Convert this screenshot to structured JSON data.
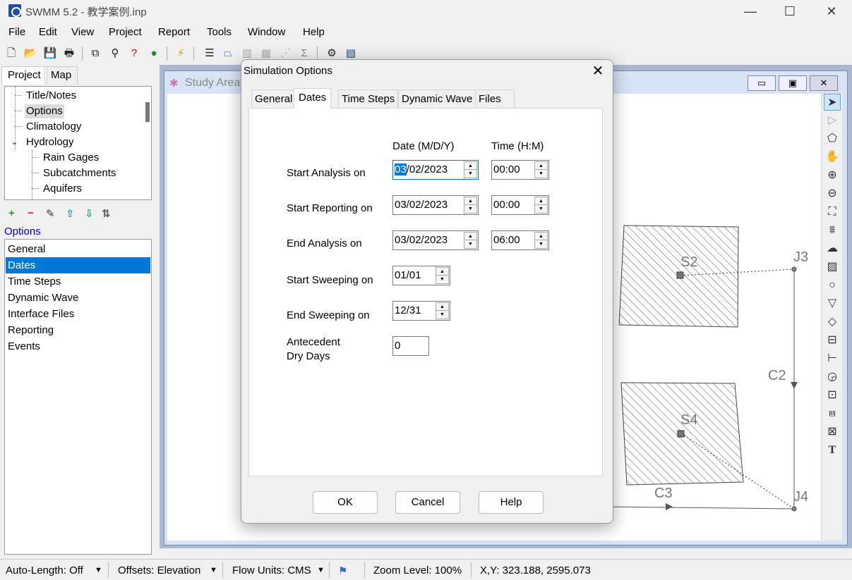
{
  "app": {
    "title": "SWMM 5.2 - 教学案例.inp",
    "window_controls": [
      "—",
      "☐",
      "✕"
    ]
  },
  "menu": [
    "File",
    "Edit",
    "View",
    "Project",
    "Report",
    "Tools",
    "Window",
    "Help"
  ],
  "project_panel": {
    "tabs": [
      "Project",
      "Map"
    ],
    "tree": [
      "Title/Notes",
      "Options",
      "Climatology",
      "Hydrology",
      "Rain Gages",
      "Subcatchments",
      "Aquifers"
    ],
    "options_label": "Options",
    "options_list": [
      "General",
      "Dates",
      "Time Steps",
      "Dynamic Wave",
      "Interface Files",
      "Reporting",
      "Events"
    ]
  },
  "map_window": {
    "title": "Study Area",
    "buttons": [
      "▭",
      "▣",
      "✕"
    ],
    "nodes": [
      "J3",
      "J4"
    ],
    "links": [
      "C2",
      "C3"
    ],
    "subcatchments": [
      "S2",
      "S4"
    ]
  },
  "dialog": {
    "title": "Simulation Options",
    "close_icon": "✕",
    "tabs": [
      "General",
      "Dates",
      "Time Steps",
      "Dynamic Wave",
      "Files"
    ],
    "col_date": "Date (M/D/Y)",
    "col_time": "Time (H:M)",
    "rows": {
      "start_analysis": {
        "label": "Start Analysis on",
        "date_selected": "03",
        "date_rest": "/02/2023",
        "time": "00:00"
      },
      "start_reporting": {
        "label": "Start Reporting on",
        "date": "03/02/2023",
        "time": "00:00"
      },
      "end_analysis": {
        "label": "End Analysis on",
        "date": "03/02/2023",
        "time": "06:00"
      },
      "start_sweeping": {
        "label": "Start Sweeping on",
        "date": "01/01"
      },
      "end_sweeping": {
        "label": "End Sweeping on",
        "date": "12/31"
      },
      "antecedent": {
        "label_line1": "Antecedent",
        "label_line2": "Dry Days",
        "value": "0"
      }
    },
    "buttons": {
      "ok": "OK",
      "cancel": "Cancel",
      "help": "Help"
    }
  },
  "status": {
    "auto_length": "Auto-Length: Off",
    "offsets": "Offsets: Elevation",
    "flow_units": "Flow Units: CMS",
    "zoom": "Zoom Level: 100%",
    "xy": "X,Y: 323.188, 2595.073"
  }
}
